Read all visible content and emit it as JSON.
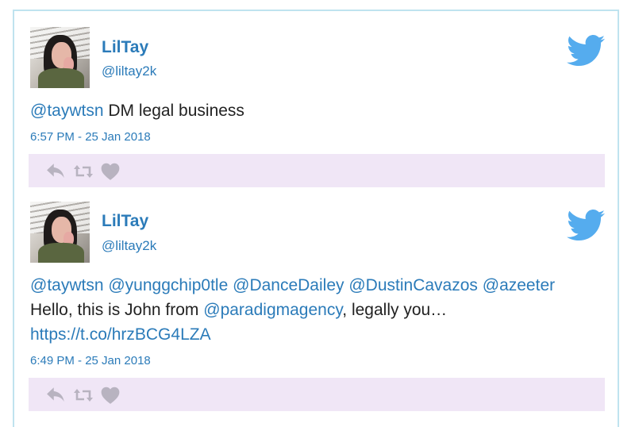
{
  "tweets": [
    {
      "name": "LilTay",
      "handle": "@liltay2k",
      "text": [
        {
          "t": "@taywtsn",
          "link": true
        },
        {
          "t": " DM legal business",
          "link": false
        }
      ],
      "time": "6:57 PM - 25 Jan 2018",
      "actions": [
        "reply-icon",
        "retweet-icon",
        "like-icon"
      ]
    },
    {
      "name": "LilTay",
      "handle": "@liltay2k",
      "text": [
        {
          "t": "@taywtsn",
          "link": true
        },
        {
          "t": " ",
          "link": false
        },
        {
          "t": "@yunggchip0tle",
          "link": true
        },
        {
          "t": " ",
          "link": false
        },
        {
          "t": "@DanceDailey",
          "link": true
        },
        {
          "t": " ",
          "link": false
        },
        {
          "t": "@DustinCavazos",
          "link": true
        },
        {
          "t": " ",
          "link": false
        },
        {
          "t": "@azeeter",
          "link": true
        },
        {
          "t": " Hello, this is John from ",
          "link": false
        },
        {
          "t": "@paradigmagency",
          "link": true
        },
        {
          "t": ", legally you… ",
          "link": false
        },
        {
          "t": "https://t.co/hrzBCG4LZA",
          "link": true
        }
      ],
      "time": "6:49 PM - 25 Jan 2018",
      "actions": [
        "reply-icon",
        "retweet-icon",
        "like-icon"
      ]
    }
  ],
  "colors": {
    "link": "#2b7bb9",
    "bird": "#55acee",
    "action_bar": "#f0e6f6",
    "action_icon": "#b8b3c0",
    "border": "#bfe3ef"
  }
}
